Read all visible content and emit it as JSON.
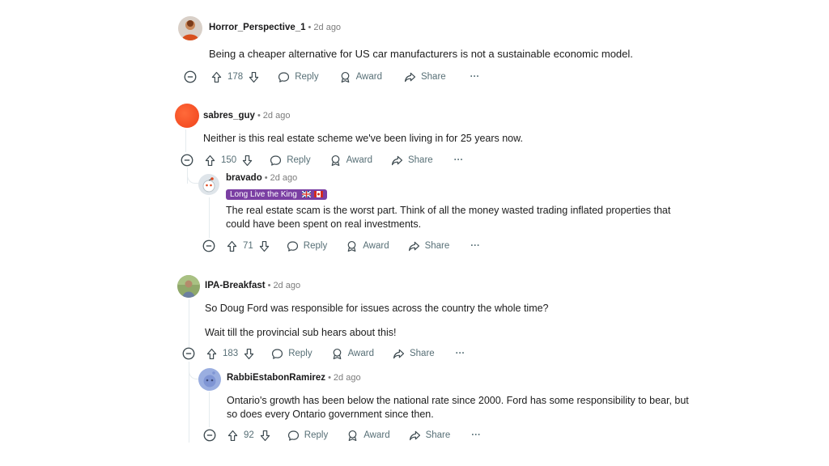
{
  "comments": [
    {
      "user": "Horror_Perspective_1",
      "time": "2d ago",
      "text": "Being a cheaper alternative for US car manufacturers is not a sustainable economic model.",
      "votes": "178"
    },
    {
      "user": "sabres_guy",
      "time": "2d ago",
      "text": "Neither is this real estate scheme we've been living in for 25 years now.",
      "votes": "150"
    },
    {
      "user": "bravado",
      "time": "2d ago",
      "flair": "Long Live the King",
      "text_line1": "The real estate scam is the worst part. Think of all the money wasted trading inflated properties that",
      "text_line2": "could have been spent on real investments.",
      "votes": "71"
    },
    {
      "user": "IPA-Breakfast",
      "time": "2d ago",
      "text_line1": "So Doug Ford was responsible for issues across the country the whole time?",
      "text_line2": "Wait till the provincial sub hears about this!",
      "votes": "183"
    },
    {
      "user": "RabbiEstabonRamirez",
      "time": "2d ago",
      "text_line1": "Ontario's growth has been below the national rate since 2000. Ford has some responsibility to bear, but",
      "text_line2": "so does every Ontario government since then.",
      "votes": "92"
    }
  ],
  "actions": {
    "reply": "Reply",
    "award": "Award",
    "share": "Share",
    "more": "···",
    "separator": "•"
  },
  "colors": {
    "flair_bg": "#7b3fa3",
    "action_text": "#576f76",
    "thread_line": "#e5ebee"
  }
}
